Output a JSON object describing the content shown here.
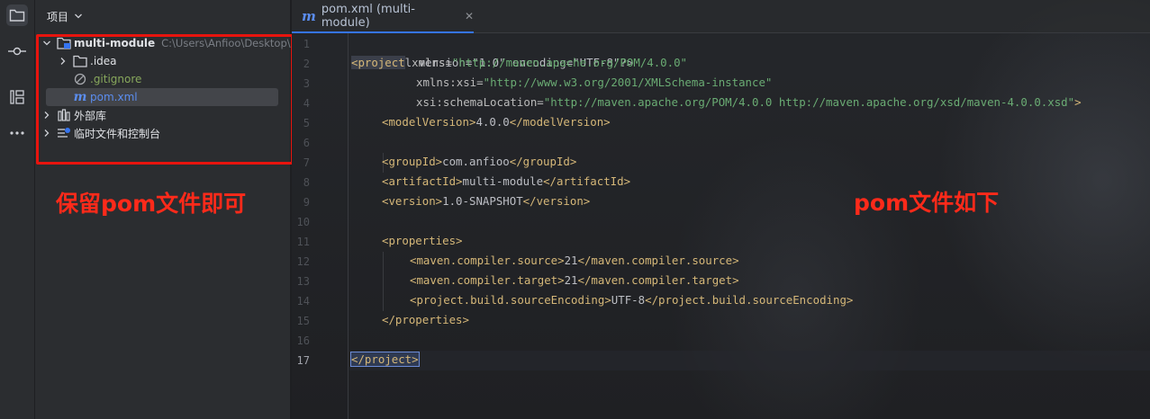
{
  "activity_bar": {
    "icons": [
      "folder-icon",
      "commit-icon",
      "structure-icon",
      "more-icon"
    ]
  },
  "project_panel": {
    "title": "项目",
    "tree": [
      {
        "label": "multi-module",
        "path": "C:\\Users\\Anfioo\\Desktop\\",
        "icon": "module-folder-icon",
        "expanded": true
      },
      {
        "label": ".idea",
        "icon": "folder-icon",
        "expanded": false
      },
      {
        "label": ".gitignore",
        "icon": "ignored-file-icon"
      },
      {
        "label": "pom.xml",
        "icon": "maven-icon",
        "selected": true
      },
      {
        "label": "外部库",
        "icon": "library-icon",
        "expanded": false
      },
      {
        "label": "临时文件和控制台",
        "icon": "scratch-icon",
        "expanded": false
      }
    ]
  },
  "annotations": {
    "left": "保留pom文件即可",
    "right": "pom文件如下"
  },
  "editor": {
    "tab_label": "pom.xml (multi-module)",
    "tab_icon": "m",
    "current_line": 17,
    "line_numbers": [
      "1",
      "2",
      "3",
      "4",
      "5",
      "6",
      "7",
      "8",
      "9",
      "10",
      "11",
      "12",
      "13",
      "14",
      "15",
      "16",
      "17"
    ]
  },
  "code": {
    "l1_decl": "<?xml version=\"1.0\" encoding=\"UTF-8\"?>",
    "l2_open": "<",
    "l2_tag": "project",
    "l2_attr": " xmlns=",
    "l2_val": "\"http://maven.apache.org/POM/4.0.0\"",
    "l3_attr": "xmlns:xsi=",
    "l3_val": "\"http://www.w3.org/2001/XMLSchema-instance\"",
    "l4_attr": "xsi:schemaLocation=",
    "l4_val": "\"http://maven.apache.org/POM/4.0.0 http://maven.apache.org/xsd/maven-4.0.0.xsd\"",
    "l4_close": ">",
    "l5_open": "<modelVersion>",
    "l5_text": "4.0.0",
    "l5_close": "</modelVersion>",
    "l7_open": "<groupId>",
    "l7_text": "com.anfioo",
    "l7_close": "</groupId>",
    "l8_open": "<artifactId>",
    "l8_text": "multi-module",
    "l8_close": "</artifactId>",
    "l9_open": "<version>",
    "l9_text": "1.0-SNAPSHOT",
    "l9_close": "</version>",
    "l11_open": "<properties>",
    "l12_open": "<maven.compiler.source>",
    "l12_text": "21",
    "l12_close": "</maven.compiler.source>",
    "l13_open": "<maven.compiler.target>",
    "l13_text": "21",
    "l13_close": "</maven.compiler.target>",
    "l14_open": "<project.build.sourceEncoding>",
    "l14_text": "UTF-8",
    "l14_close": "</project.build.sourceEncoding>",
    "l15_close": "</properties>",
    "l17_open": "</",
    "l17_tag": "project",
    "l17_close": ">"
  }
}
